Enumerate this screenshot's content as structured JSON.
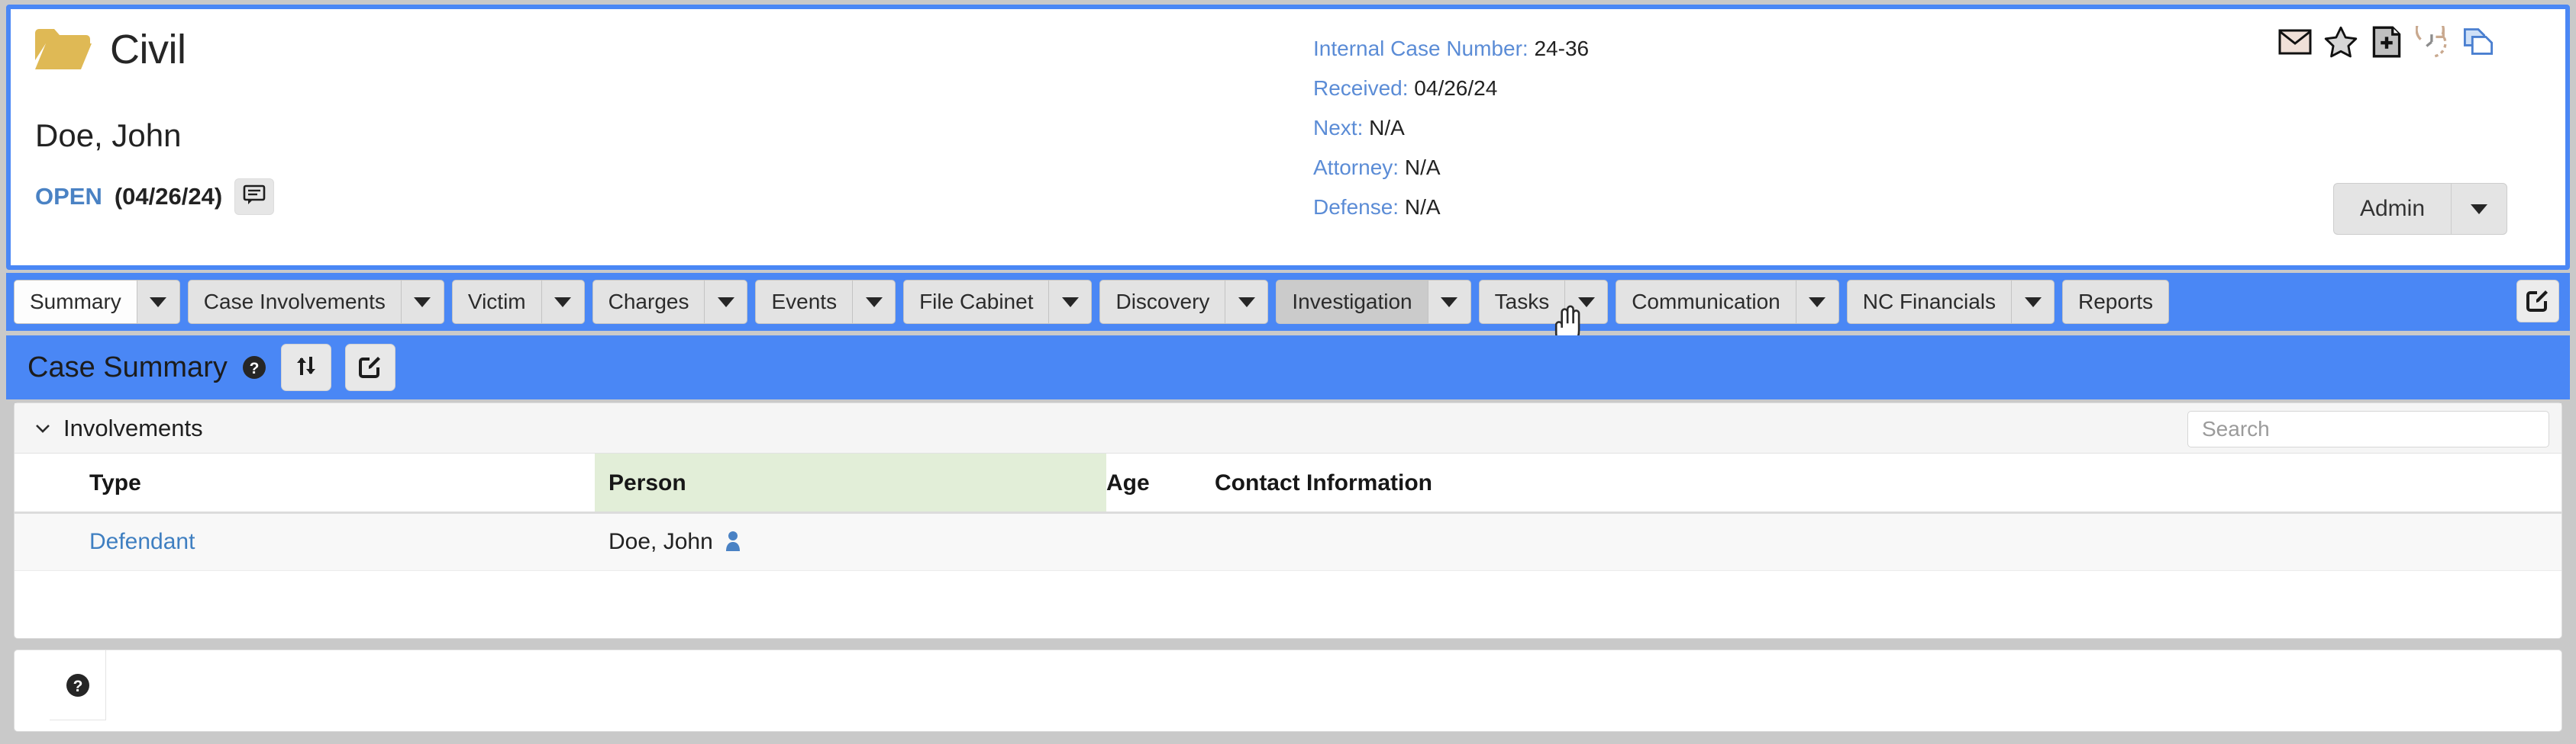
{
  "case": {
    "type": "Civil",
    "person": "Doe, John",
    "status": "OPEN",
    "status_date": "(04/26/24)",
    "folder_icon": "folder-open-icon",
    "note_icon": "comment-note-icon",
    "folder_color": "#dfb955",
    "status_color": "#4a82c4"
  },
  "meta": [
    {
      "label": "Internal Case Number:",
      "value": "24-36"
    },
    {
      "label": "Received:",
      "value": "04/26/24"
    },
    {
      "label": "Next:",
      "value": "N/A"
    },
    {
      "label": "Attorney:",
      "value": "N/A"
    },
    {
      "label": "Defense:",
      "value": "N/A"
    }
  ],
  "header_icons": [
    {
      "name": "envelope-icon"
    },
    {
      "name": "star-icon"
    },
    {
      "name": "add-document-icon"
    },
    {
      "name": "history-clock-icon"
    },
    {
      "name": "copy-documents-icon"
    }
  ],
  "admin": {
    "label": "Admin",
    "caret_icon": "chevron-down-icon"
  },
  "tabs": [
    {
      "label": "Summary",
      "caret": true,
      "state": "active"
    },
    {
      "label": "Case Involvements",
      "caret": true,
      "state": "normal"
    },
    {
      "label": "Victim",
      "caret": true,
      "state": "normal"
    },
    {
      "label": "Charges",
      "caret": true,
      "state": "normal"
    },
    {
      "label": "Events",
      "caret": true,
      "state": "normal"
    },
    {
      "label": "File Cabinet",
      "caret": true,
      "state": "normal"
    },
    {
      "label": "Discovery",
      "caret": true,
      "state": "normal"
    },
    {
      "label": "Investigation",
      "caret": true,
      "state": "hover"
    },
    {
      "label": "Tasks",
      "caret": true,
      "state": "normal"
    },
    {
      "label": "Communication",
      "caret": true,
      "state": "normal"
    },
    {
      "label": "NC Financials",
      "caret": true,
      "state": "normal"
    },
    {
      "label": "Reports",
      "caret": false,
      "state": "normal"
    }
  ],
  "tabbar": {
    "edit_icon": "edit-pencil-icon",
    "accent_color": "#4a87f5"
  },
  "summary": {
    "title": "Case Summary",
    "help_icon": "help-circle-icon",
    "swap_icon": "swap-arrows-icon",
    "edit_icon": "edit-pencil-icon"
  },
  "involvements": {
    "label": "Involvements",
    "chevron_icon": "chevron-down-icon",
    "expanded": true,
    "search": {
      "value": "",
      "placeholder": "Search"
    },
    "columns": [
      {
        "key": "type",
        "label": "Type",
        "sorted": false
      },
      {
        "key": "person",
        "label": "Person",
        "sorted": true
      },
      {
        "key": "age",
        "label": "Age",
        "sorted": false
      },
      {
        "key": "contact",
        "label": "Contact Information",
        "sorted": false
      }
    ],
    "rows": [
      {
        "type": "Defendant",
        "person": "Doe, John",
        "person_icon": "person-icon",
        "age": "",
        "contact": ""
      }
    ],
    "sorted_column_color": "#e2eed8"
  },
  "bottom": {
    "help_icon": "help-circle-icon"
  }
}
